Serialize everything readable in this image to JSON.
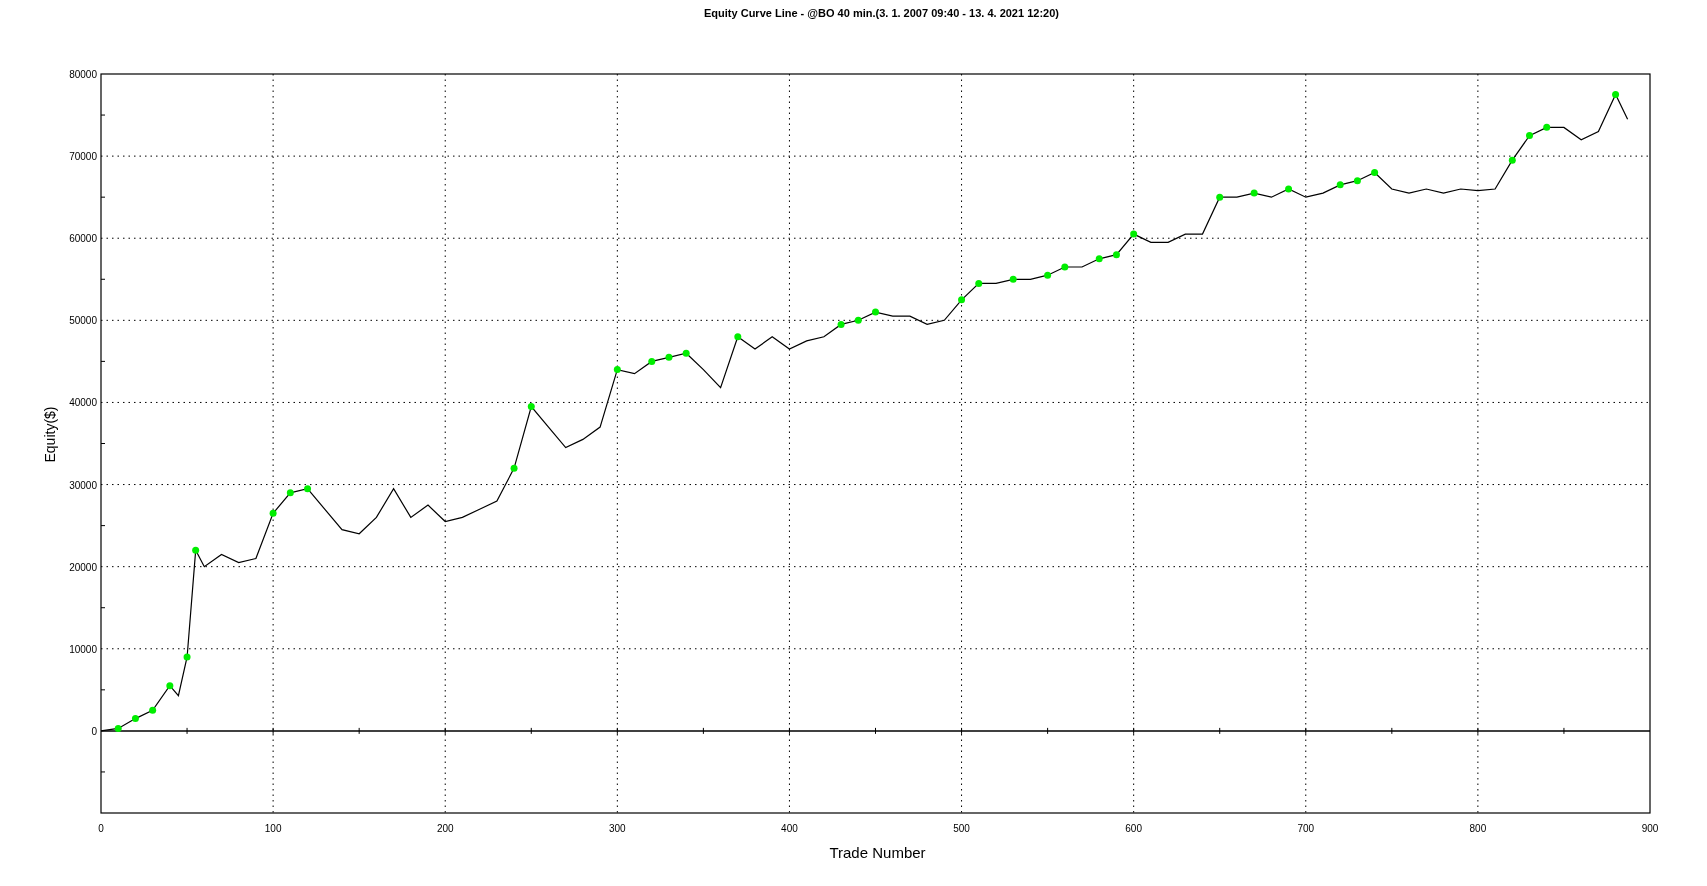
{
  "chart": {
    "title": "Equity Curve Line - @BO 40 min.(3. 1. 2007 09:40 - 13. 4. 2021 12:20)",
    "chart_data": {
      "type": "line",
      "grid": true,
      "xlabel": "Trade Number",
      "ylabel": "Equity($)",
      "x": [
        0,
        10,
        20,
        30,
        40,
        45,
        50,
        55,
        60,
        70,
        80,
        90,
        100,
        110,
        120,
        130,
        140,
        150,
        160,
        170,
        180,
        190,
        200,
        210,
        220,
        230,
        240,
        250,
        260,
        270,
        280,
        290,
        300,
        310,
        320,
        330,
        340,
        350,
        360,
        370,
        380,
        390,
        400,
        410,
        420,
        430,
        440,
        450,
        460,
        470,
        480,
        490,
        500,
        510,
        520,
        530,
        540,
        550,
        560,
        570,
        580,
        590,
        600,
        610,
        620,
        630,
        640,
        650,
        660,
        670,
        680,
        690,
        700,
        710,
        720,
        730,
        740,
        750,
        760,
        770,
        780,
        790,
        800,
        810,
        820,
        830,
        840,
        850,
        860,
        870,
        880,
        887
      ],
      "series": [
        {
          "color": "#000000",
          "values": [
            0,
            300,
            1500,
            2500,
            5500,
            4300,
            9000,
            22000,
            20000,
            21500,
            20500,
            21000,
            26500,
            29000,
            29500,
            27000,
            24500,
            24000,
            26000,
            29500,
            26000,
            27500,
            25500,
            26000,
            27000,
            28000,
            32000,
            39500,
            37000,
            34500,
            35500,
            37000,
            44000,
            43500,
            45000,
            45500,
            46000,
            44000,
            41800,
            48000,
            46500,
            48000,
            46500,
            47500,
            48000,
            49500,
            50000,
            51000,
            50500,
            50500,
            49500,
            50000,
            52500,
            54500,
            54500,
            55000,
            55000,
            55500,
            56500,
            56500,
            57500,
            58000,
            60500,
            59500,
            59500,
            60500,
            60500,
            65000,
            65000,
            65500,
            65000,
            66000,
            65000,
            65500,
            66500,
            67000,
            68000,
            66000,
            65500,
            66000,
            65500,
            66000,
            65800,
            66000,
            69500,
            72500,
            73500,
            73500,
            72000,
            73000,
            77500,
            74500
          ]
        }
      ],
      "xlim": [
        0,
        900
      ],
      "ylim": [
        -10000,
        80000
      ],
      "xticks": [
        0,
        100,
        200,
        300,
        400,
        500,
        600,
        700,
        800,
        900
      ],
      "yticks": [
        0,
        10000,
        20000,
        30000,
        40000,
        50000,
        60000,
        70000,
        80000
      ]
    }
  }
}
